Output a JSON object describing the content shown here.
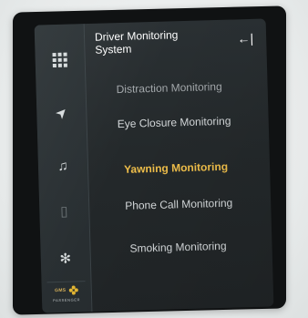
{
  "header": {
    "title": "Driver Monitoring System",
    "back_icon": "back-arrow-icon",
    "back_glyph": "←|"
  },
  "menu": {
    "items": [
      {
        "label": "Distraction Monitoring",
        "state": "dimmed"
      },
      {
        "label": "Eye Closure Monitoring",
        "state": "normal"
      },
      {
        "label": "Yawning Monitoring",
        "state": "selected"
      },
      {
        "label": "Phone Call Monitoring",
        "state": "normal"
      },
      {
        "label": "Smoking Monitoring",
        "state": "normal"
      }
    ]
  },
  "rail": {
    "icons": [
      "apps-grid-icon",
      "navigation-icon",
      "music-icon",
      "phone-icon",
      "fan-icon"
    ],
    "music_glyph": "♫",
    "nav_glyph": "➤",
    "phone_glyph": "▯",
    "fan_glyph": "✻"
  },
  "logo": {
    "text": "GMS",
    "subtext": "PASSENGER"
  },
  "colors": {
    "selected": "#f0bf4a",
    "text": "#d5d9db",
    "dimmed": "#a3a8ab",
    "background": "#24292b"
  }
}
